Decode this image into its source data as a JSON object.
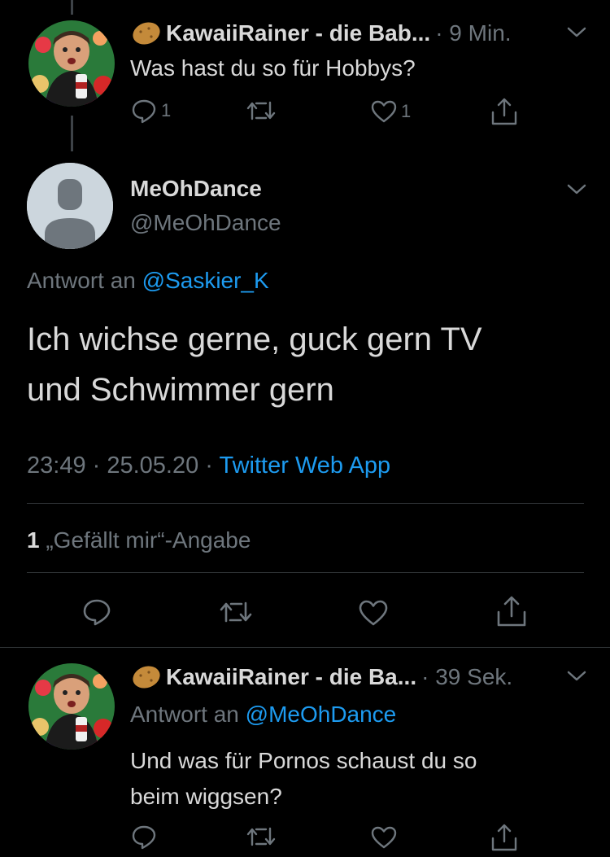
{
  "tweet1": {
    "display_name": "KawaiiRainer - die Bab...",
    "time": "· 9 Min.",
    "text": "Was hast du so für Hobbys?",
    "reply_count": "1",
    "like_count": "1"
  },
  "main": {
    "display_name": "MeOhDance",
    "handle": "@MeOhDance",
    "reply_prefix": "Antwort an",
    "reply_to": "@Saskier_K",
    "text_line1": "Ich wichse gerne, guck gern TV",
    "text_line2": "und Schwimmer gern",
    "time": "23:49 · 25.05.20 · ",
    "source": "Twitter Web App",
    "likes_count": "1",
    "likes_label": " „Gefällt mir“-Angabe"
  },
  "tweet3": {
    "display_name": "KawaiiRainer - die Ba...",
    "time": "· 39 Sek.",
    "reply_prefix": "Antwort an",
    "reply_to": "@MeOhDance",
    "text_line1": "Und was für Pornos schaust du so",
    "text_line2": "beim wiggsen?"
  },
  "colors": {
    "background": "#000000",
    "text": "#d9d9d9",
    "muted": "#6e767d",
    "link": "#1d9bf0"
  },
  "icons": [
    "potato-emoji-icon",
    "chevron-down-icon",
    "reply-icon",
    "retweet-icon",
    "like-icon",
    "share-icon"
  ]
}
